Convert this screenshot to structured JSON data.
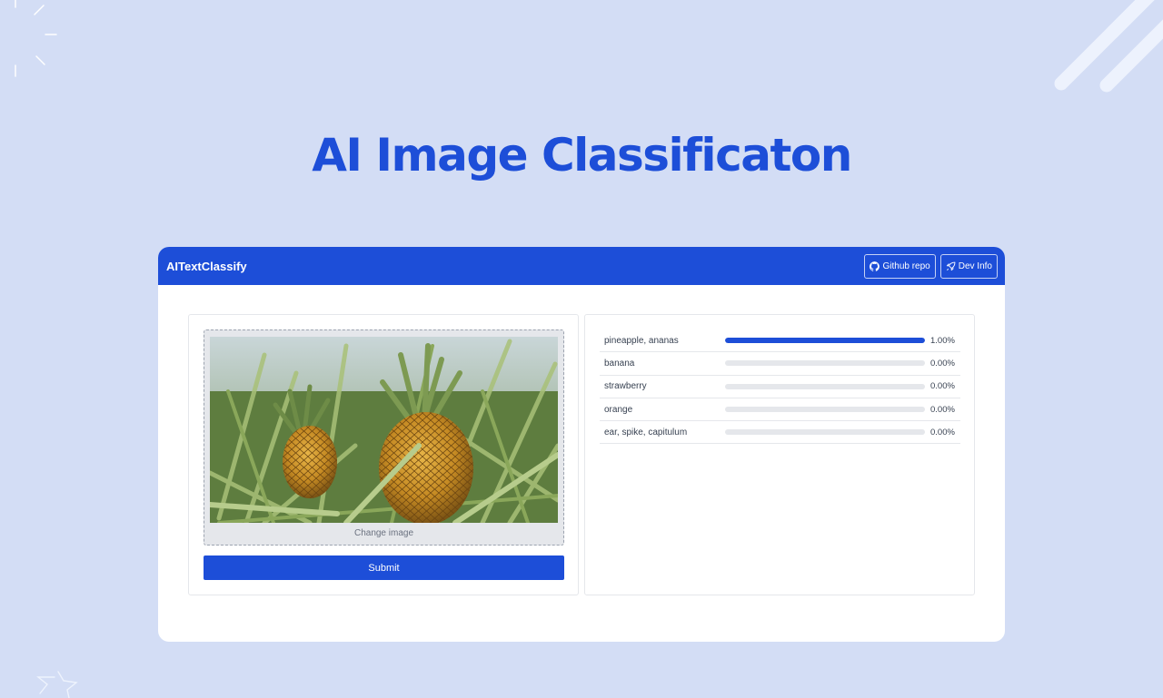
{
  "hero": {
    "title": "AI Image Classificaton"
  },
  "app": {
    "brand": "AITextClassify",
    "header_buttons": [
      {
        "label": "Github repo",
        "icon": "github-icon"
      },
      {
        "label": "Dev Info",
        "icon": "rocket-icon"
      }
    ]
  },
  "upload": {
    "change_label": "Change image",
    "submit_label": "Submit",
    "image_subject": "pineapple-photo"
  },
  "results": [
    {
      "label": "pineapple, ananas",
      "value": "1.00%",
      "fill": 1.0
    },
    {
      "label": "banana",
      "value": "0.00%",
      "fill": 0.0
    },
    {
      "label": "strawberry",
      "value": "0.00%",
      "fill": 0.0
    },
    {
      "label": "orange",
      "value": "0.00%",
      "fill": 0.0
    },
    {
      "label": "ear, spike, capitulum",
      "value": "0.00%",
      "fill": 0.0
    }
  ],
  "colors": {
    "accent": "#1d4ed8",
    "background": "#d3ddf5"
  }
}
